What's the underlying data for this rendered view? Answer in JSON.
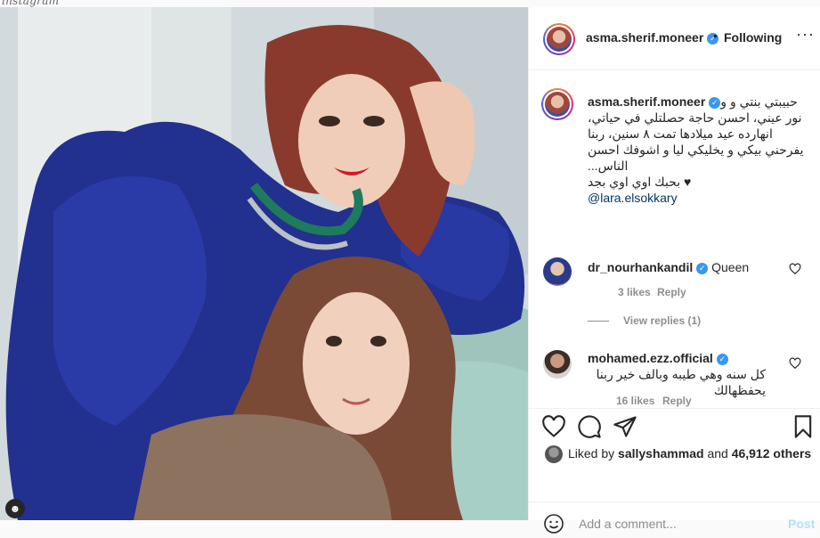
{
  "browser_strip": {
    "partial_text": "instagram"
  },
  "post": {
    "author": {
      "username": "asma.sherif.moneer",
      "verified": true,
      "follow_status": "Following",
      "separator": "•"
    },
    "caption": {
      "username": "asma.sherif.moneer",
      "text": "حبيبتي بنتي و و نور عيني، احسن حاجة حصلتلي في حياتي، انهارده عيد ميلادها تمت ٨ سنين، ربنا يفرحني بيكي و يخليكي ليا و اشوفك احسن الناس...",
      "text_line2": "♥ بحبك اوي اوي بجد",
      "mention": "@lara.elsokkary"
    },
    "comments": [
      {
        "username": "dr_nourhankandil",
        "verified": true,
        "text": "Queen",
        "likes": "3 likes",
        "reply_label": "Reply",
        "view_replies": "View replies (1)"
      },
      {
        "username": "mohamed.ezz.official",
        "verified": true,
        "text": "كل سنه وهي طيبه وبالف خير ربنا يحفظهالك",
        "likes": "16 likes",
        "reply_label": "Reply"
      }
    ],
    "likes_line": {
      "prefix": "Liked by",
      "liker": "sallyshammad",
      "conjunction": "and",
      "count": "46,912 others"
    },
    "add_comment": {
      "placeholder": "Add a comment...",
      "post_label": "Post"
    }
  },
  "icons": {
    "more": "more-options-icon",
    "like": "heart-icon",
    "comment": "comment-icon",
    "share": "share-icon",
    "save": "bookmark-icon",
    "emoji": "emoji-icon"
  },
  "colors": {
    "verified": "#3897f0",
    "post_button_disabled": "#b2dffc",
    "meta_gray": "#8e8e8e"
  }
}
